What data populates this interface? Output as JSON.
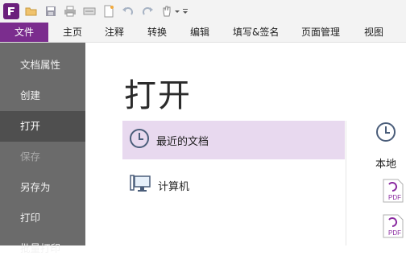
{
  "menubar": {
    "items": [
      "文件",
      "主页",
      "注释",
      "转换",
      "编辑",
      "填写&签名",
      "页面管理",
      "视图"
    ]
  },
  "leftnav": {
    "items": [
      "文档属性",
      "创建",
      "打开",
      "保存",
      "另存为",
      "打印",
      "批量打印"
    ]
  },
  "main": {
    "title": "打开",
    "options": [
      "最近的文档",
      "计算机"
    ]
  },
  "right_panel": {
    "section_label": "本地",
    "file_badge": "PDF"
  },
  "colors": {
    "accent": "#7b2d8e",
    "nav_bg": "#6b6b6b",
    "nav_selected": "#4f4f4f",
    "option_selected": "#e8d9ef"
  }
}
